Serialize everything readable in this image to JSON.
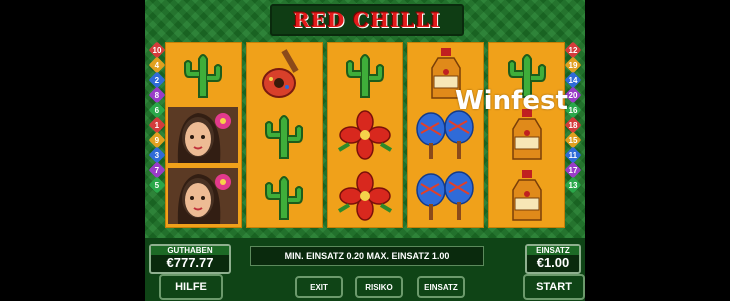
{
  "game": {
    "title": "RED CHILLI"
  },
  "reels": [
    [
      "cactus-icon",
      "woman-icon",
      "woman-icon"
    ],
    [
      "guitar-icon",
      "cactus-icon",
      "cactus-icon"
    ],
    [
      "cactus-icon",
      "flower-icon",
      "flower-icon"
    ],
    [
      "tequila-bottle-icon",
      "maracas-icon",
      "maracas-icon"
    ],
    [
      "cactus-icon",
      "tequila-bottle-icon",
      "tequila-bottle-icon"
    ]
  ],
  "paylines": {
    "left": [
      "10",
      "4",
      "2",
      "8",
      "6",
      "1",
      "9",
      "3",
      "7",
      "5"
    ],
    "right": [
      "12",
      "19",
      "14",
      "20",
      "16",
      "18",
      "15",
      "11",
      "17",
      "13"
    ],
    "colors": [
      "#d43c3c",
      "#e0a020",
      "#2f6bd8",
      "#9a3cc8",
      "#2aa84a"
    ]
  },
  "balance": {
    "label": "GUTHABEN",
    "value": "€777.77"
  },
  "bet_info": "MIN. EINSATZ 0.20 MAX. EINSATZ 1.00",
  "stake": {
    "label": "EINSATZ",
    "value": "€1.00"
  },
  "buttons": {
    "help": "HILFE",
    "exit": "EXIT",
    "risk": "RISIKO",
    "stake": "EINSATZ",
    "start": "START"
  },
  "watermark": "Winfest"
}
